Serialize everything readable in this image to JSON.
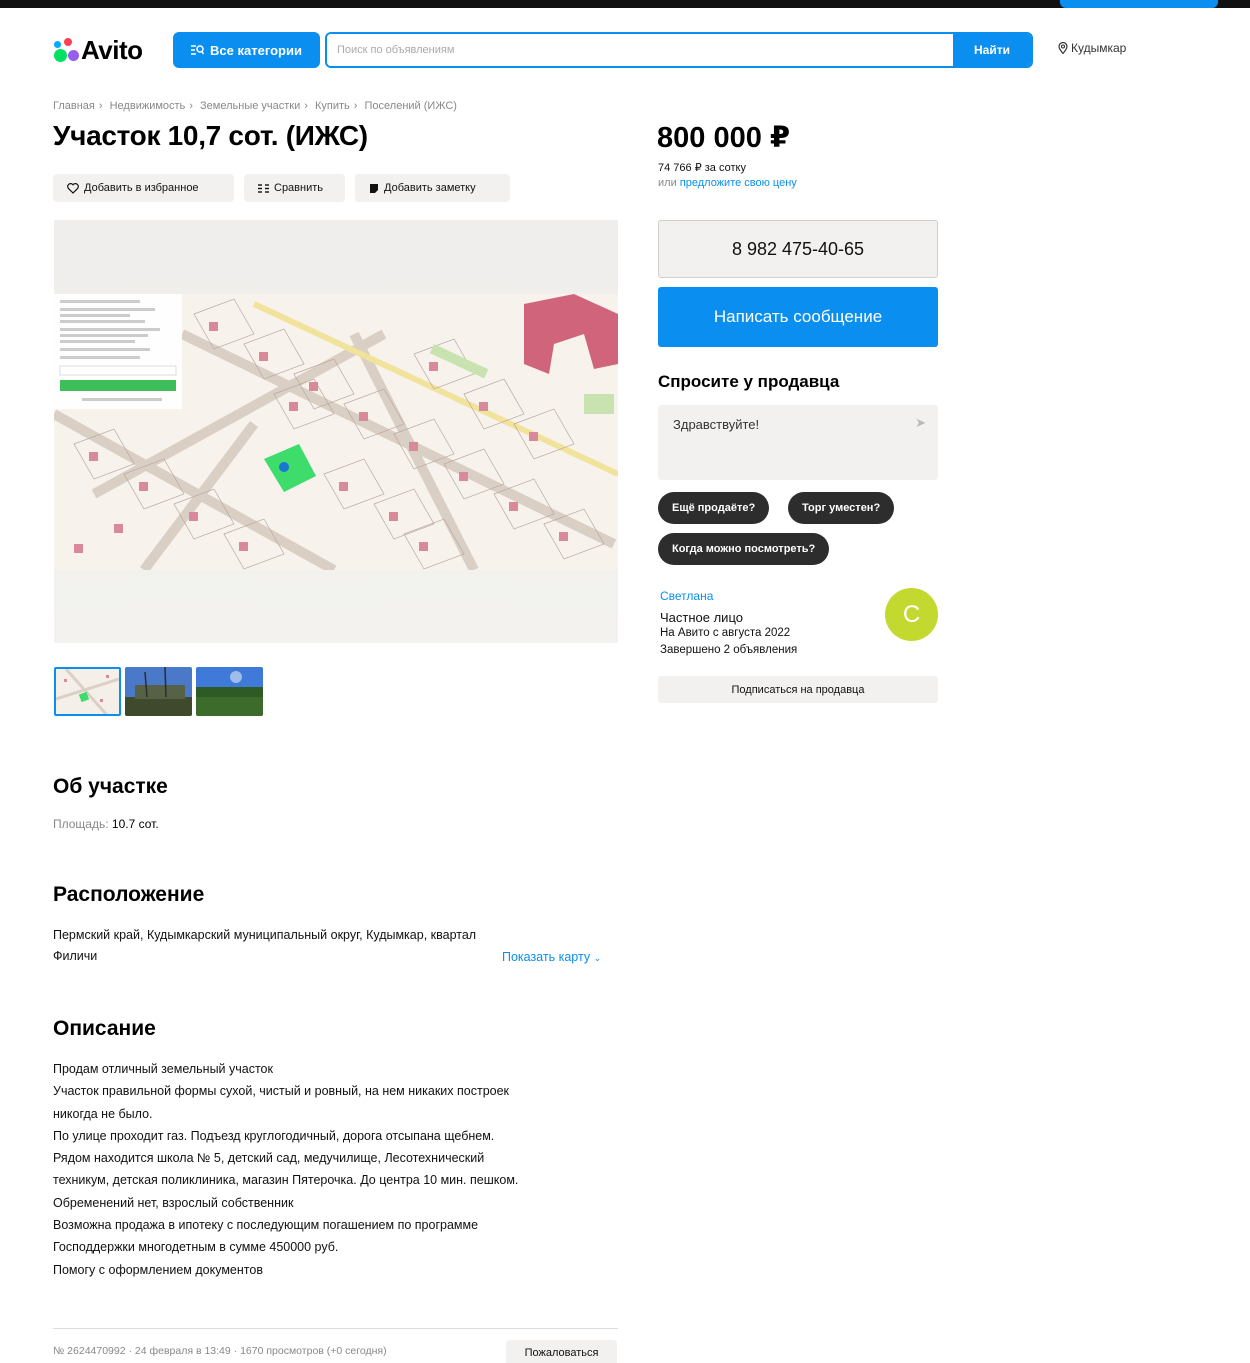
{
  "header": {
    "logo_text": "Avito",
    "categories_button": "Все категории",
    "search_placeholder": "Поиск по объявлениям",
    "search_button": "Найти",
    "location": "Кудымкар"
  },
  "breadcrumb": [
    "Главная",
    "Недвижимость",
    "Земельные участки",
    "Купить",
    "Поселений (ИЖС)"
  ],
  "breadcrumb_sep": "›",
  "listing": {
    "title": "Участок 10,7 сот. (ИЖС)",
    "actions": {
      "favorite": "Добавить в избранное",
      "compare": "Сравнить",
      "note": "Добавить заметку"
    },
    "thumbnail_count": 3
  },
  "about": {
    "heading": "Об участке",
    "area_label": "Площадь:",
    "area_value": "10.7 сот."
  },
  "location_section": {
    "heading": "Расположение",
    "address": "Пермский край, Кудымкарский муниципальный округ, Кудымкар, квартал Филичи",
    "show_map": "Показать карту"
  },
  "description": {
    "heading": "Описание",
    "lines": [
      "Продам отличный земельный участок",
      "Участок правильной формы сухой, чистый и ровный, на нем никаких построек",
      "никогда не было.",
      "По улице проходит газ. Подъезд круглогодичный, дорога отсыпана щебнем.",
      "Рядом находится школа № 5, детский сад, медучилище, Лесотехнический",
      "техникум, детская поликлиника, магазин Пятерочка. До центра 10 мин. пешком.",
      "Обременений нет, взрослый собственник",
      "Возможна продажа в ипотеку с последующим погашением по программе",
      "Господдержки многодетным в сумме 450000 руб.",
      "Помогу с оформлением документов"
    ]
  },
  "footer": {
    "meta": "№ 2624470992 · 24 февраля в 13:49 · 1670 просмотров (+0 сегодня)",
    "report_button": "Пожаловаться"
  },
  "sidebar": {
    "price": "800 000 ₽",
    "price_per_sotka": "74 766 ₽ за сотку",
    "offer_prefix": "или",
    "offer_link": "предложите свою цену",
    "phone": "8 982 475-40-65",
    "message_button": "Написать сообщение",
    "ask_title": "Спросите у продавца",
    "ask_input": "Здравствуйте!",
    "quick_questions": [
      "Ещё продаёте?",
      "Торг уместен?",
      "Когда можно посмотреть?"
    ],
    "seller": {
      "name": "Светлана",
      "type": "Частное лицо",
      "since": "На Авито с августа 2022",
      "completed": "Завершено 2 объявления",
      "avatar_letter": "С",
      "avatar_color": "#c3d92f"
    },
    "subscribe_button": "Подписаться на продавца"
  },
  "colors": {
    "accent": "#0a8ff0",
    "chip_bg": "#2d2d2d",
    "button_bg": "#f2f1f0"
  }
}
